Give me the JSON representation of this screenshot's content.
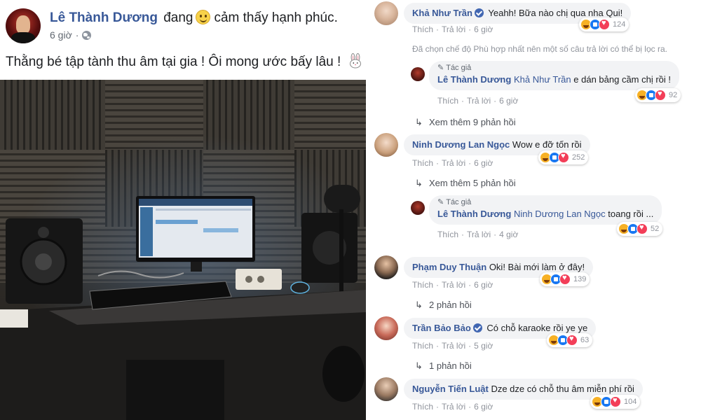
{
  "post": {
    "author": "Lê Thành Dương",
    "feeling_prefix": "đang",
    "feeling_icon": "smiley-icon",
    "feeling_text": "cảm thấy hạnh phúc.",
    "time": "6 giờ",
    "privacy_icon": "globe-icon",
    "body": "Thằng bé tập tành thu âm tại gia ! Ôi mong ước bấy lâu !",
    "body_emoji": "rabbit-icon"
  },
  "actions": {
    "like": "Thích",
    "reply": "Trả lời",
    "dot": "·"
  },
  "author_badge": "Tác giả",
  "comments": [
    {
      "name": "Khả Như Trần",
      "verified": true,
      "text": "Yeahh! Bữa nào chị qua nha Qui!",
      "time": "6 giờ",
      "reactions": 124
    },
    {
      "filter_note": "Đã chọn chế độ Phù hợp nhất nên một số câu trả lời có thể bị lọc ra."
    },
    {
      "name": "Lê Thành Dương",
      "author_reply": true,
      "tag": "Khả Như Trần",
      "text": "e dán bảng cầm chị rồi !",
      "time": "6 giờ",
      "reactions": 92
    },
    {
      "more": "Xem thêm 9 phản hồi"
    },
    {
      "name": "Ninh Dương Lan Ngọc",
      "text": "Wow e đỡ tốn rồi",
      "time": "6 giờ",
      "reactions": 252
    },
    {
      "more": "Xem thêm 5 phản hồi"
    },
    {
      "name": "Lê Thành Dương",
      "author_reply": true,
      "tag": "Ninh Dương Lan Ngọc",
      "text": "toang rồi ...",
      "time": "4 giờ",
      "reactions": 52
    },
    {
      "name": "Phạm Duy Thuận",
      "text": "Oki! Bài mới làm ở đây!",
      "time": "6 giờ",
      "reactions": 139
    },
    {
      "more": "2 phản hồi"
    },
    {
      "name": "Trần Bảo Bảo",
      "verified": true,
      "text": "Có chỗ karaoke rồi ye ye",
      "time": "5 giờ",
      "reactions": 63
    },
    {
      "more": "1 phản hồi"
    },
    {
      "name": "Nguyễn Tiến Luật",
      "text": "Dze dze có chỗ thu âm miễn phí rồi",
      "time": "6 giờ",
      "reactions": 104
    }
  ],
  "colors": {
    "link": "#385898",
    "bubble": "#f2f3f5",
    "meta": "#90949c",
    "like": "#1877f2",
    "love": "#f33e58",
    "haha": "#f7b125"
  }
}
